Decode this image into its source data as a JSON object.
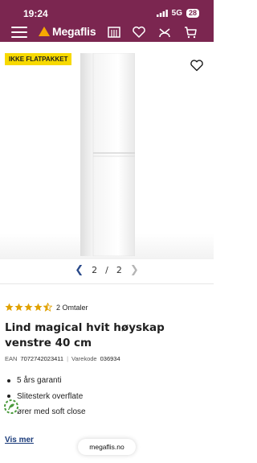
{
  "status_bar": {
    "time": "19:24",
    "network": "5G",
    "battery": "28"
  },
  "header": {
    "logo_text": "Megaflis"
  },
  "product_image": {
    "badge": "IKKE FLATPAKKET",
    "current_page": "2",
    "separator": "/",
    "total_pages": "2"
  },
  "rating": {
    "stars": 4.5,
    "max_stars": 5,
    "reviews_text": "2 Omtaler"
  },
  "product": {
    "title": "Lind magical hvit høyskap venstre 40 cm",
    "ean_label": "EAN",
    "ean": "7072742023411",
    "sku_label": "Varekode",
    "sku": "036934"
  },
  "features": [
    "5 års garanti",
    "Slitesterk overflate",
    "ører med soft close"
  ],
  "see_more": "Vis mer",
  "browser_url": "megaflis.no",
  "colors": {
    "brand": "#7b2650",
    "badge": "#f7d900",
    "star": "#e0a100",
    "link": "#1a3b7a"
  }
}
